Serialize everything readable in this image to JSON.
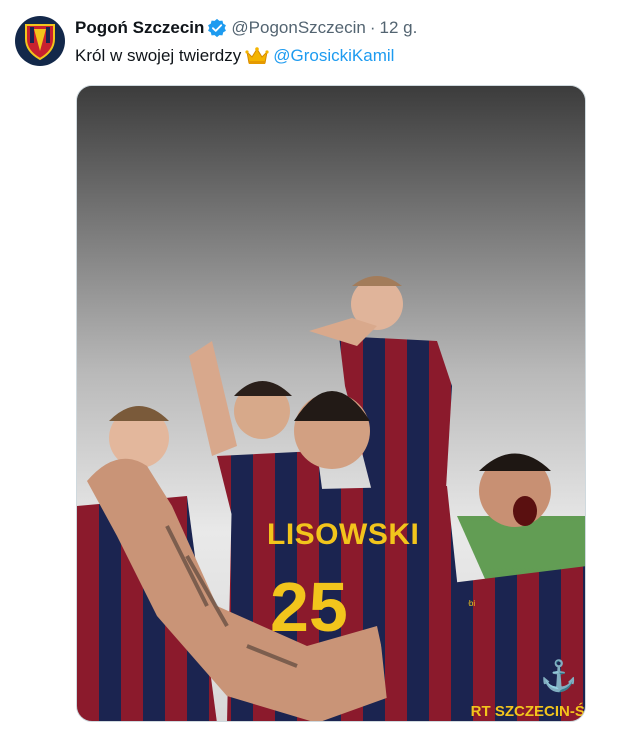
{
  "tweet": {
    "author_name": "Pogoń Szczecin",
    "handle": "@PogonSzczecin",
    "separator": "·",
    "time": "12 g.",
    "text_prefix": "Król w swojej twierdzy",
    "mention": "@GrosickiKamil"
  },
  "photo": {
    "jersey_name": "LISOWSKI",
    "jersey_number": "25",
    "sponsor_text": "PORT SZCZECIN-ŚWI",
    "jersey_brand": "Jakobi"
  },
  "icons": {
    "avatar": "club-crest-icon",
    "verified": "verified-badge-icon",
    "crown": "crown-emoji-icon"
  },
  "colors": {
    "mention": "#1d9bf0",
    "verified": "#1d9bf0",
    "avatar_bg": "#13284a",
    "jersey_red": "#8b1a2c",
    "jersey_navy": "#1b2450",
    "jersey_yellow": "#f2c51c"
  }
}
